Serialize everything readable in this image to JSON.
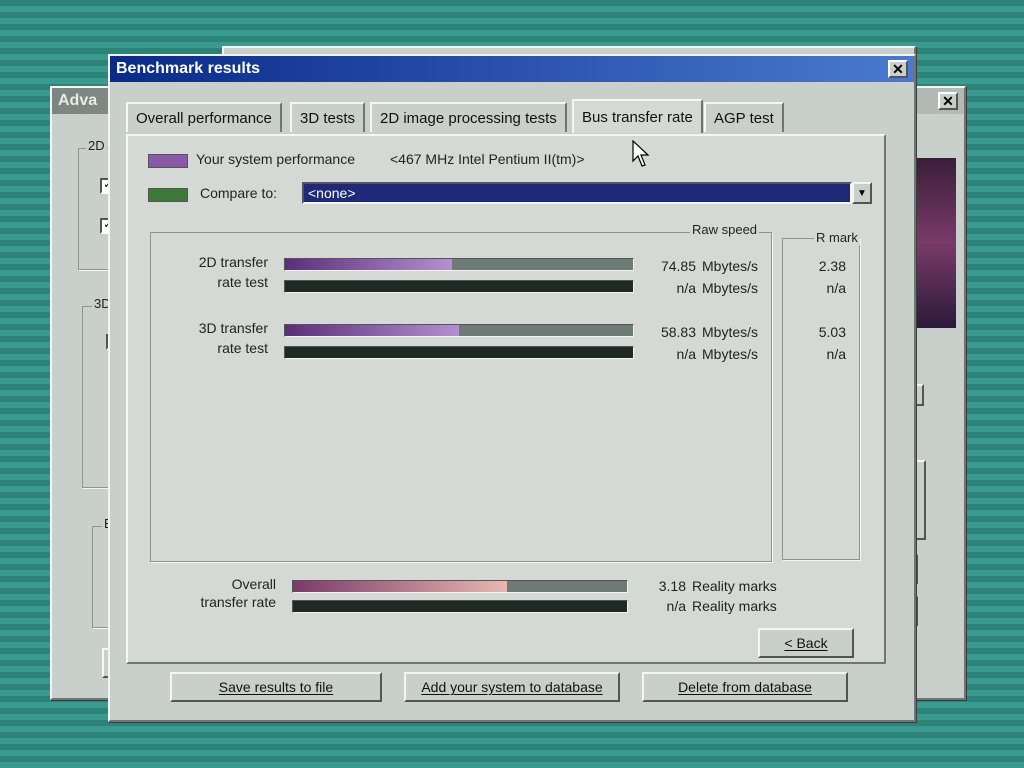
{
  "back_window": {
    "title": "Adva",
    "groups": [
      "2D",
      "3D",
      "Bu"
    ]
  },
  "main": {
    "title": "Benchmark results",
    "tabs": [
      {
        "label": "Overall performance"
      },
      {
        "label": "3D tests"
      },
      {
        "label": "2D image processing tests"
      },
      {
        "label": "Bus transfer rate"
      },
      {
        "label": "AGP test"
      }
    ],
    "system_label": "Your system performance",
    "system_value": "<467 MHz Intel Pentium II(tm)>",
    "compare_label": "Compare to:",
    "compare_value": "<none>",
    "col_raw": "Raw speed",
    "col_rmark": "R mark",
    "tests": [
      {
        "line1": "2D transfer",
        "line2": "rate test",
        "value1": "74.85",
        "unit1": "Mbytes/s",
        "rmark1": "2.38",
        "value2": "n/a",
        "unit2": "Mbytes/s",
        "rmark2": "n/a",
        "fill": 0.48
      },
      {
        "line1": "3D transfer",
        "line2": "rate test",
        "value1": "58.83",
        "unit1": "Mbytes/s",
        "rmark1": "5.03",
        "value2": "n/a",
        "unit2": "Mbytes/s",
        "rmark2": "n/a",
        "fill": 0.5
      }
    ],
    "overall": {
      "line1": "Overall",
      "line2": "transfer rate",
      "value1": "3.18",
      "unit1": "Reality marks",
      "value2": "n/a",
      "unit2": "Reality marks",
      "fill": 0.64
    },
    "back_button": "< Back",
    "buttons": {
      "save": "Save results to file",
      "add": "Add your system to database",
      "delete": "Delete from database"
    }
  },
  "colors": {
    "system_swatch": "#8a5aa8",
    "compare_swatch": "#3d7a3a"
  }
}
